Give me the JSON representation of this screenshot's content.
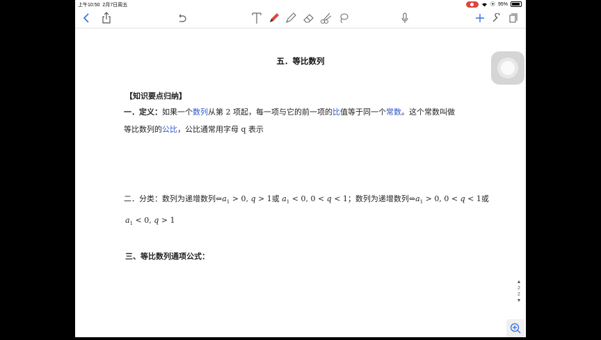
{
  "status_bar": {
    "time": "上午10:50",
    "date": "2月7日周五",
    "battery": "95%",
    "battery_level": 0.95
  },
  "toolbar": {
    "icons": [
      "back-chevron-icon",
      "share-icon",
      "undo-icon",
      "text-tool-icon",
      "pen-icon",
      "highlighter-icon",
      "eraser-icon",
      "scissors-icon",
      "lasso-icon",
      "microphone-icon",
      "add-icon",
      "wrench-icon",
      "pages-icon"
    ]
  },
  "document": {
    "title": "五．等比数列",
    "section_heading": "【知识要点归纳】",
    "def_label": "一．定义：",
    "def_text_1": "如果一个",
    "def_link_1": "数列",
    "def_text_2": "从第 2 项起，每一项与它的前一项的",
    "def_link_2": "比",
    "def_text_3": "值等于同一个",
    "def_link_3": "常数",
    "def_text_4": "。这个常数叫做",
    "def_line2_a": "等比数列的",
    "def_link_4": "公比",
    "def_line2_b": "，公比通常用字母 q 表示",
    "class_line_1a": "二．分类：数列为递增数列⇔",
    "class_line_1b": " > 0, ",
    "class_line_1c": " > 1或 ",
    "class_line_1d": " < 0, 0 < ",
    "class_line_1e": " < 1；数列为递增数列⇔",
    "class_line_1f": " > 0, 0 < ",
    "class_line_1g": " < 1或",
    "class_line_2a": " < 0, ",
    "class_line_2b": " > 1",
    "var_a": "a",
    "var_sub": "1",
    "var_q": "q",
    "formula_heading": "三、等比数列通项公式："
  },
  "page_indicator": {
    "current": "2",
    "total": "2"
  }
}
